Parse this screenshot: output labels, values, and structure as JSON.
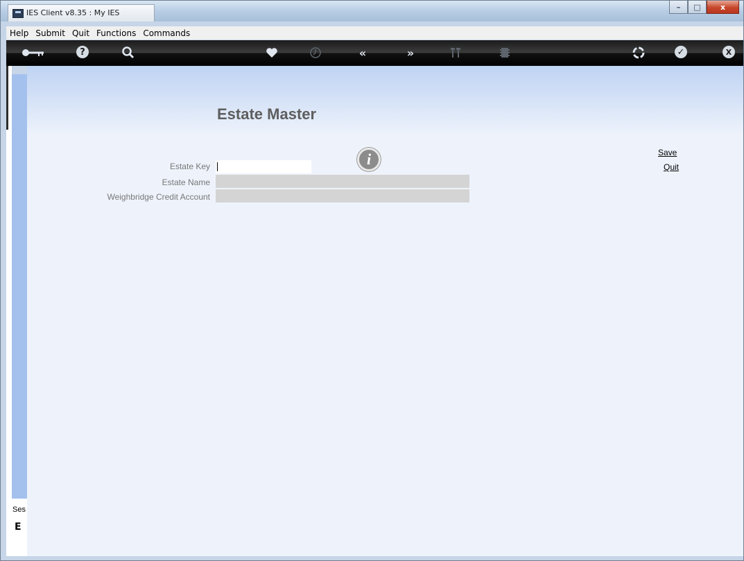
{
  "window": {
    "title": "IES Client v8.35 : My IES",
    "controls": {
      "minimize": "–",
      "maximize": "□",
      "close": "x"
    }
  },
  "menu": {
    "items": [
      "Help",
      "Submit",
      "Quit",
      "Functions",
      "Commands"
    ]
  },
  "toolbar": {
    "icons": [
      "key-icon",
      "help-icon",
      "search-icon",
      "heart-icon",
      "clock-icon",
      "rewind-icon",
      "forward-icon",
      "tools-icon",
      "chip-icon",
      "recycle-icon",
      "check-icon",
      "close-icon"
    ]
  },
  "form": {
    "title": "Estate Master",
    "fields": [
      {
        "label": "Estate Key",
        "value": ""
      },
      {
        "label": "Estate Name",
        "value": ""
      },
      {
        "label": "Weighbridge Credit Account",
        "value": ""
      }
    ],
    "info_glyph": "i"
  },
  "actions": {
    "save": "Save",
    "quit": "Quit"
  },
  "session": {
    "label": "Ses",
    "glyph": "E"
  }
}
